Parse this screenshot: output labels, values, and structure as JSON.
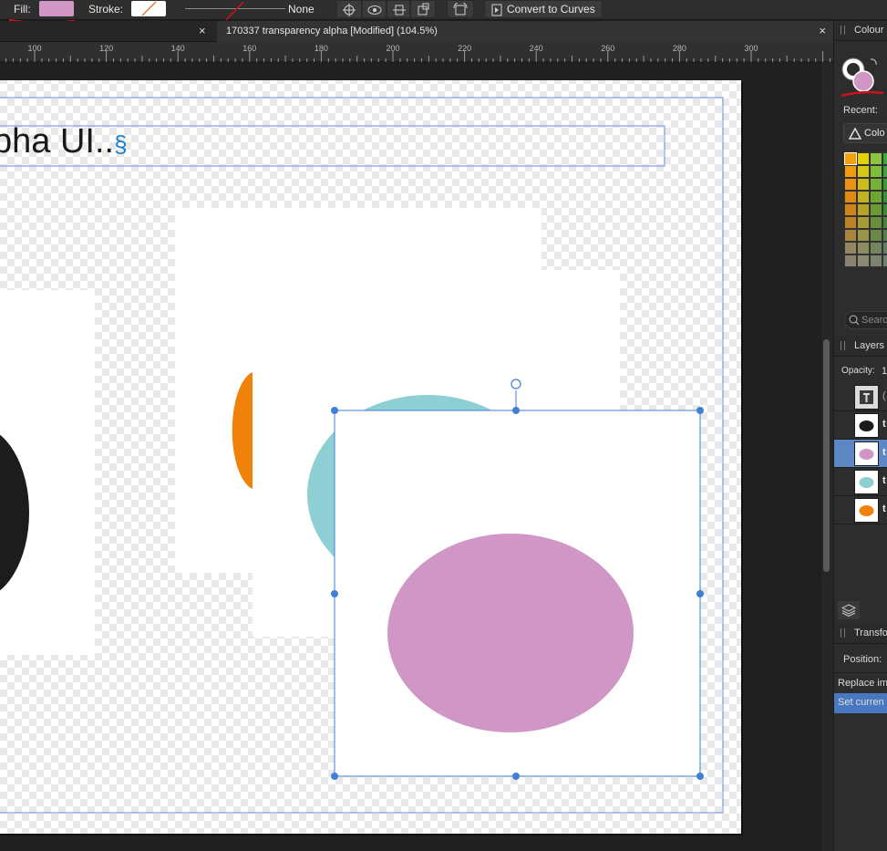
{
  "toolbar": {
    "fill_label": "Fill:",
    "fill_color": "#cf96c6",
    "stroke_label": "Stroke:",
    "stroke_value": "None",
    "convert_label": "Convert to Curves"
  },
  "tabs": {
    "prev_close": "×",
    "active_title": "170337 transparency alpha [Modified] (104.5%)",
    "active_close": "×"
  },
  "ruler": {
    "ticks": [
      "100",
      "120",
      "140",
      "160",
      "180",
      "200",
      "220",
      "240",
      "260",
      "280",
      "300"
    ]
  },
  "document": {
    "text": "pha UI..",
    "section_mark": "§",
    "shape_colors": {
      "black": "#1c1c1c",
      "orange": "#f0820c",
      "teal": "#8dcfd3",
      "pink": "#cf96c6",
      "selection": "#3f7fd6"
    }
  },
  "panel": {
    "colour_title": "Colour",
    "recent_label": "Recent:",
    "colour_dropdown": "Colo",
    "search_placeholder": "Search",
    "layers_title": "Layers",
    "opacity_label": "Opacity:",
    "opacity_value": "1",
    "layers": [
      {
        "name": "(",
        "thumb": "text-frame"
      },
      {
        "name": "t",
        "thumb": "black-ellipse"
      },
      {
        "name": "t",
        "thumb": "pink-ellipse",
        "selected": true
      },
      {
        "name": "t",
        "thumb": "teal-ellipse"
      },
      {
        "name": "t",
        "thumb": "orange-ellipse"
      }
    ],
    "transform_title": "Transfo",
    "position_label": "Position:",
    "history_items": [
      "Replace im",
      "Set curren"
    ]
  }
}
